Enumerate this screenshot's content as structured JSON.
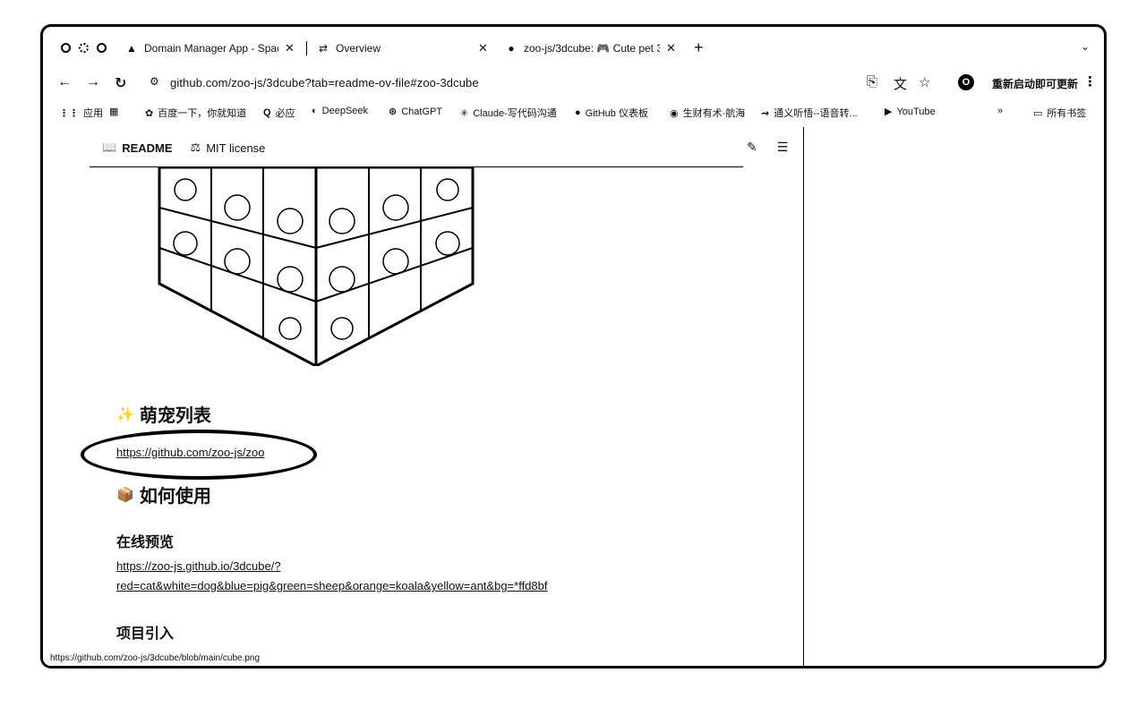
{
  "tabs": [
    {
      "title": "Domain Manager App - Space",
      "icon": "▲"
    },
    {
      "title": "Overview",
      "icon": "⇄"
    },
    {
      "title": "zoo-js/3dcube: 🎮 Cute pet 3",
      "icon": "●"
    }
  ],
  "toolbar": {
    "url": "github.com/zoo-js/3dcube?tab=readme-ov-file#zoo-3dcube",
    "profile_letter": "O",
    "update_label": "重新启动即可更新"
  },
  "bookmarks": [
    {
      "label": "应用",
      "icon": "⋮⋮"
    },
    {
      "label": "",
      "icon": "▦"
    },
    {
      "label": "百度一下，你就知道",
      "icon": "✿"
    },
    {
      "label": "必应",
      "icon": "Q"
    },
    {
      "label": "DeepSeek",
      "icon": "◐"
    },
    {
      "label": "ChatGPT",
      "icon": "⊛"
    },
    {
      "label": "Claude-写代码沟通",
      "icon": "✳"
    },
    {
      "label": "GitHub 仪表板",
      "icon": "●"
    },
    {
      "label": "生财有术·航海",
      "icon": "◉"
    },
    {
      "label": "通义听悟--语音转...",
      "icon": "⇝"
    },
    {
      "label": "YouTube",
      "icon": "▶"
    },
    {
      "label": "»",
      "icon": ""
    },
    {
      "label": "所有书签",
      "icon": "▭"
    }
  ],
  "readme": {
    "tab_readme": "README",
    "tab_license": "MIT license",
    "heading_pets": "萌宠列表",
    "pets_link": "https://github.com/zoo-js/zoo",
    "heading_use": "如何使用",
    "heading_online": "在线预览",
    "preview_link_line1": "https://zoo-js.github.io/3dcube/?",
    "preview_link_line2": "red=cat&white=dog&blue=pig&green=sheep&orange=koala&yellow=ant&bg=*ffd8bf",
    "heading_import": "项目引入"
  },
  "status_url": "https://github.com/zoo-js/3dcube/blob/main/cube.png"
}
